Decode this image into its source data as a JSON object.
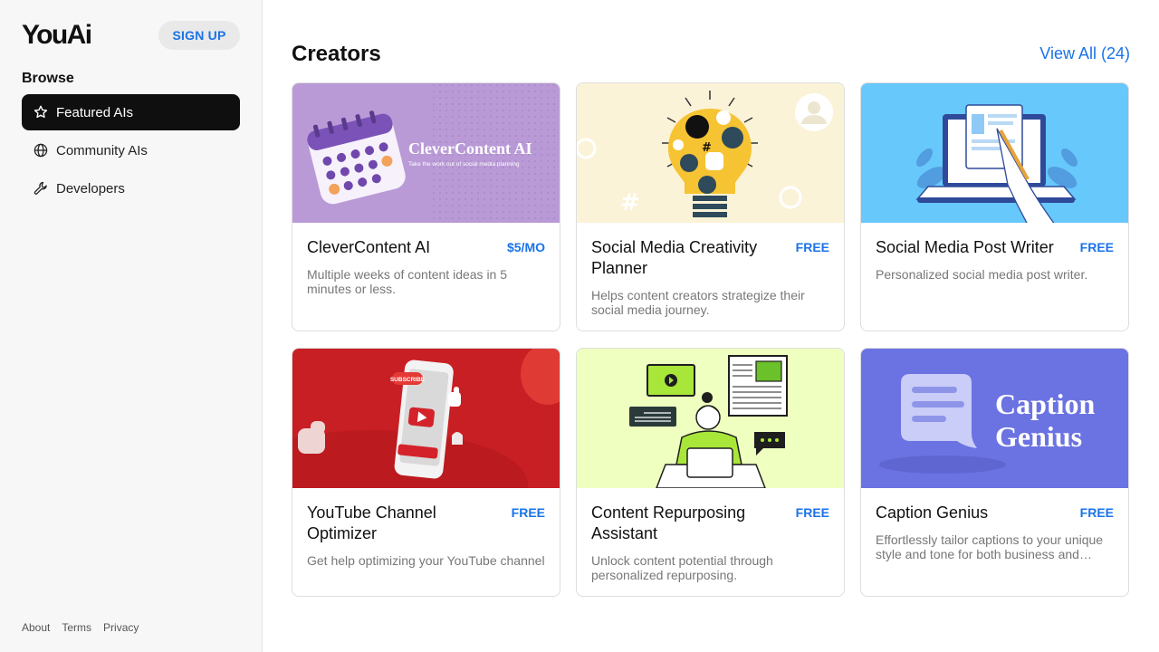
{
  "app": {
    "logo": "YouAi",
    "signup_label": "SIGN UP"
  },
  "sidebar": {
    "browse_label": "Browse",
    "items": [
      {
        "label": "Featured AIs",
        "icon": "star-icon",
        "active": true
      },
      {
        "label": "Community AIs",
        "icon": "globe-icon",
        "active": false
      },
      {
        "label": "Developers",
        "icon": "wrench-icon",
        "active": false
      }
    ],
    "footer": [
      "About",
      "Terms",
      "Privacy"
    ]
  },
  "section": {
    "title": "Creators",
    "view_all": "View All (24)"
  },
  "colors": {
    "accent": "#1a73e8",
    "active_nav": "#0f0f0f"
  },
  "cards": [
    {
      "title": "CleverContent AI",
      "price": "$5/MO",
      "description": "Multiple weeks of content ideas in 5 minutes or less.",
      "banner_title": "CleverContent AI",
      "banner_subtitle": "Take the work out of social media planning"
    },
    {
      "title": "Social Media Creativity Planner",
      "price": "FREE",
      "description": "Helps content creators strategize their social media journey."
    },
    {
      "title": "Social Media Post Writer",
      "price": "FREE",
      "description": "Personalized social media post writer."
    },
    {
      "title": "YouTube Channel Optimizer",
      "price": "FREE",
      "description": "Get help optimizing your YouTube channel",
      "banner_badge": "SUBSCRIBE"
    },
    {
      "title": "Content Repurposing Assistant",
      "price": "FREE",
      "description": "Unlock content potential through personalized repurposing."
    },
    {
      "title": "Caption Genius",
      "price": "FREE",
      "description": "Effortlessly tailor captions to your unique style and tone for both business and personal use.",
      "banner_line1": "Caption",
      "banner_line2": "Genius"
    }
  ]
}
